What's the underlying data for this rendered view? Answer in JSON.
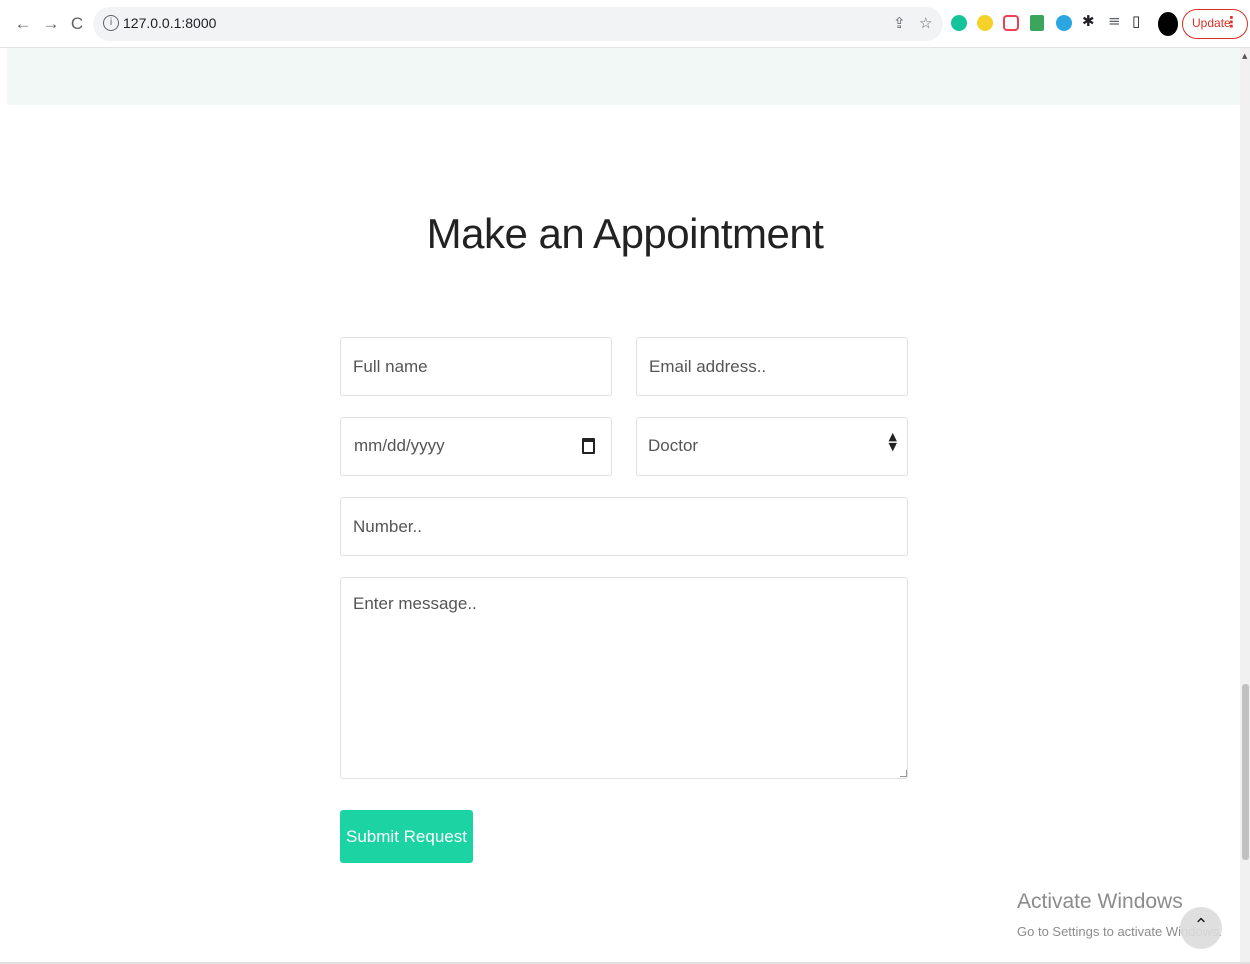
{
  "browser": {
    "back_glyph": "←",
    "forward_glyph": "→",
    "reload_glyph": "C",
    "info_glyph": "i",
    "url": "127.0.0.1:8000",
    "share_glyph": "⇪",
    "star_glyph": "☆",
    "puzzle_glyph": "✱",
    "playlist_glyph": "≡",
    "sidepanel_glyph": "▯",
    "update_label": "Update",
    "menu_glyph": "⋮",
    "colors": {
      "update": "#d93025"
    }
  },
  "page": {
    "heading": "Make an Appointment",
    "form": {
      "full_name_placeholder": "Full name",
      "email_placeholder": "Email address..",
      "date_placeholder": "mm/dd/yyyy",
      "doctor_value": "Doctor",
      "number_placeholder": "Number..",
      "message_placeholder": "Enter message..",
      "submit_label": "Submit Request"
    },
    "colors": {
      "accent": "#1bd3a3",
      "band": "#f1f8f5"
    }
  },
  "watermark": {
    "title": "Activate Windows",
    "subtitle": "Go to Settings to activate Windows.",
    "back_to_top_glyph": "⌃"
  }
}
